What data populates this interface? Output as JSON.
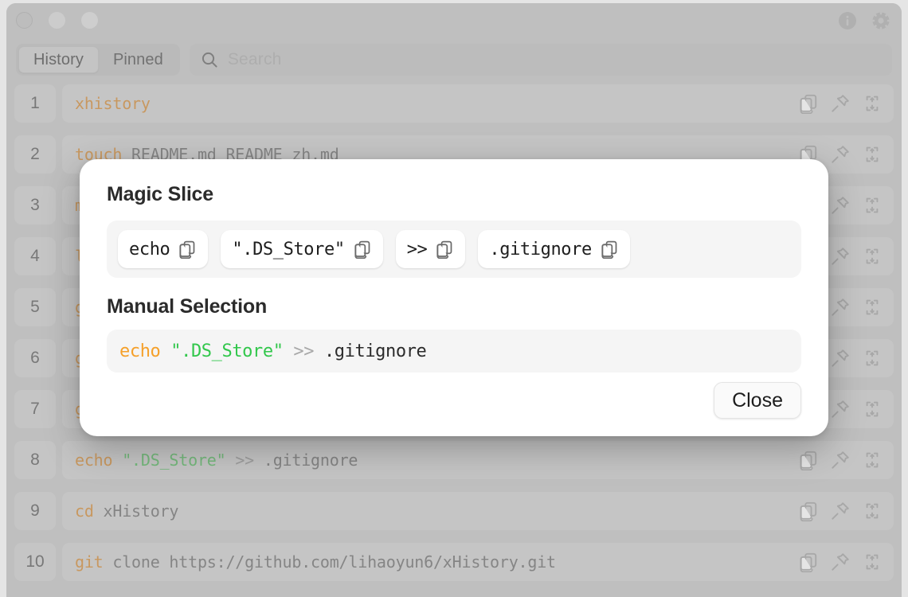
{
  "window": {
    "traffic_lights": [
      "close",
      "minimize",
      "maximize"
    ],
    "title_actions": [
      {
        "name": "info-icon",
        "label": "Info"
      },
      {
        "name": "gear-icon",
        "label": "Settings"
      }
    ]
  },
  "toolbar": {
    "tabs": [
      {
        "label": "History",
        "active": true
      },
      {
        "label": "Pinned",
        "active": false
      }
    ],
    "search": {
      "placeholder": "Search",
      "value": "",
      "icon": "search-icon"
    }
  },
  "history": {
    "row_actions": [
      {
        "name": "copy-icon",
        "label": "Copy"
      },
      {
        "name": "pin-icon",
        "label": "Pin"
      },
      {
        "name": "expand-icon",
        "label": "Expand"
      }
    ],
    "rows": [
      {
        "num": "1",
        "parts": [
          {
            "t": "xhistory",
            "c": "kw"
          }
        ]
      },
      {
        "num": "2",
        "parts": [
          {
            "t": "touch",
            "c": "kw"
          },
          {
            "t": " README.md README_zh.md",
            "c": ""
          }
        ]
      },
      {
        "num": "3",
        "parts": [
          {
            "t": "m",
            "c": "kw"
          }
        ]
      },
      {
        "num": "4",
        "parts": [
          {
            "t": "l",
            "c": "kw"
          }
        ]
      },
      {
        "num": "5",
        "parts": [
          {
            "t": "g",
            "c": "kw"
          }
        ]
      },
      {
        "num": "6",
        "parts": [
          {
            "t": "g",
            "c": "kw"
          }
        ]
      },
      {
        "num": "7",
        "parts": [
          {
            "t": "g",
            "c": "kw"
          }
        ]
      },
      {
        "num": "8",
        "parts": [
          {
            "t": "echo",
            "c": "kw"
          },
          {
            "t": " ",
            "c": ""
          },
          {
            "t": "\".DS_Store\"",
            "c": "str"
          },
          {
            "t": " ",
            "c": ""
          },
          {
            "t": ">>",
            "c": "op"
          },
          {
            "t": " .gitignore",
            "c": ""
          }
        ]
      },
      {
        "num": "9",
        "parts": [
          {
            "t": "cd",
            "c": "kw"
          },
          {
            "t": " xHistory",
            "c": ""
          }
        ]
      },
      {
        "num": "10",
        "parts": [
          {
            "t": "git",
            "c": "kw"
          },
          {
            "t": " clone https://github.com/lihaoyun6/xHistory.git",
            "c": ""
          }
        ]
      }
    ]
  },
  "dialog": {
    "title": "Magic Slice",
    "chips": [
      {
        "text": "echo",
        "icon": "copy-icon"
      },
      {
        "text": "\".DS_Store\"",
        "icon": "copy-icon"
      },
      {
        "text": ">>",
        "icon": "copy-icon"
      },
      {
        "text": ".gitignore",
        "icon": "copy-icon"
      }
    ],
    "subtitle": "Manual Selection",
    "manual_parts": [
      {
        "t": "echo",
        "c": "kw"
      },
      {
        "t": " ",
        "c": ""
      },
      {
        "t": "\".DS_Store\"",
        "c": "str"
      },
      {
        "t": " ",
        "c": ""
      },
      {
        "t": ">>",
        "c": "op"
      },
      {
        "t": " .gitignore",
        "c": ""
      }
    ],
    "close_label": "Close"
  },
  "colors": {
    "window_bg": "#c9c9c9",
    "row_bg": "#d2d2d2",
    "keyword": "#d69141",
    "string": "#5fbf69",
    "operator": "#9a9a9a",
    "dialog_bg": "#ffffff",
    "chip_box_bg": "#f5f5f5"
  }
}
